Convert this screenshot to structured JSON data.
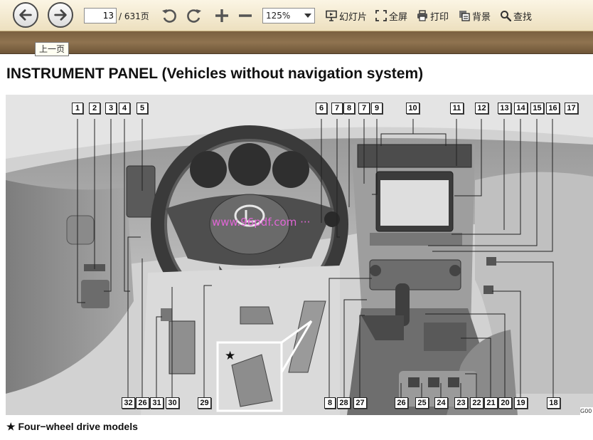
{
  "toolbar": {
    "current_page": "13",
    "total_pages": "/ 631页",
    "zoom": "125%",
    "slideshow_label": "幻灯片",
    "fullscreen_label": "全屏",
    "print_label": "打印",
    "background_label": "背景",
    "find_label": "查找"
  },
  "tooltip": "上一页",
  "document": {
    "heading": "INSTRUMENT PANEL (Vehicles without navigation system)",
    "watermark": "www.96pdf.com  ···",
    "image_code": "G00",
    "caption": "★ Four−wheel drive models",
    "inset_star": "★"
  },
  "callouts": {
    "top": [
      "1",
      "2",
      "3",
      "4",
      "5",
      "6",
      "7",
      "8",
      "7",
      "9",
      "10",
      "11",
      "12",
      "13",
      "14",
      "15",
      "16",
      "17"
    ],
    "bottom": [
      "32",
      "26",
      "31",
      "30",
      "29",
      "8",
      "28",
      "27",
      "26",
      "25",
      "24",
      "23",
      "22",
      "21",
      "20",
      "19",
      "18"
    ]
  }
}
